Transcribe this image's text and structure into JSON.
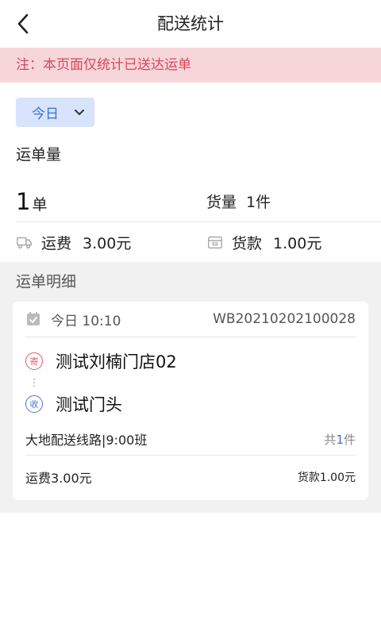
{
  "header": {
    "title": "配送统计"
  },
  "notice": {
    "text": "注：本页面仅统计已送达运单"
  },
  "filter": {
    "selected": "今日"
  },
  "summary": {
    "section_label": "运单量",
    "order_count": "1",
    "order_unit": "单",
    "goods_label": "货量",
    "goods_value": "1件",
    "freight_label": "运费",
    "freight_value": "3.00元",
    "payment_label": "货款",
    "payment_value": "1.00元"
  },
  "detail": {
    "title": "运单明细",
    "orders": [
      {
        "time": "今日 10:10",
        "order_no": "WB20210202100028",
        "sender_badge": "寄",
        "sender": "测试刘楠门店02",
        "receiver_badge": "收",
        "receiver": "测试门头",
        "route": "大地配送线路|9:00班",
        "count_prefix": "共",
        "count_num": "1",
        "count_suffix": "件",
        "freight": "运费3.00元",
        "payment": "货款1.00元"
      }
    ]
  },
  "colors": {
    "accent": "#3a6fd8",
    "notice_bg": "#f7d6d9",
    "notice_text": "#d9475a"
  }
}
